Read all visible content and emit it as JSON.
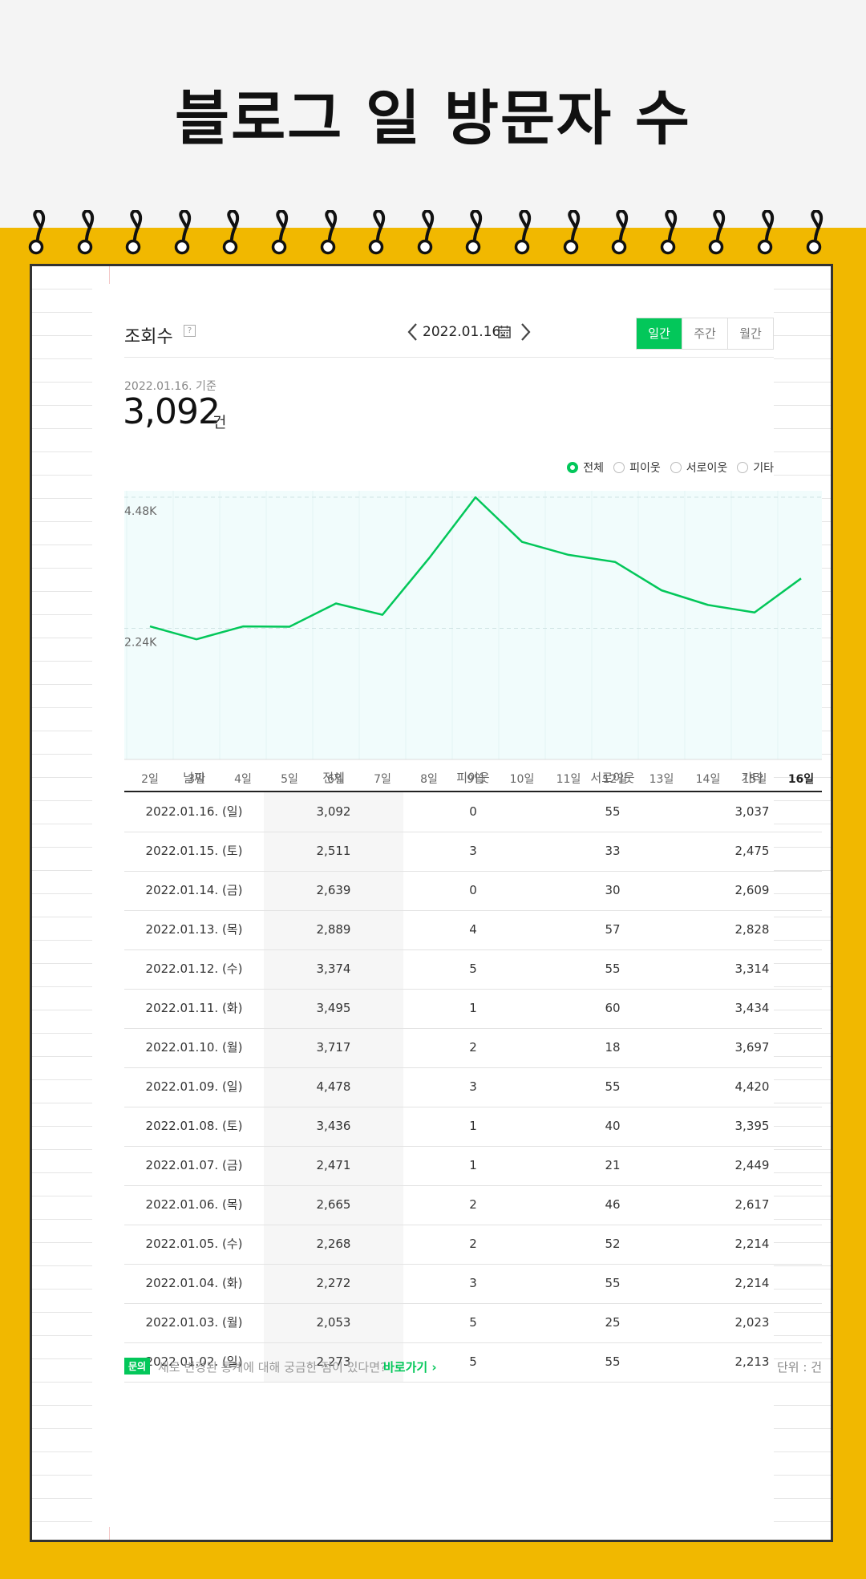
{
  "page": {
    "title": "블로그 일 방문자 수"
  },
  "stat": {
    "title": "조회수",
    "help": "?",
    "date": "2022.01.16.",
    "basis_date": "2022.01.16. 기준",
    "total": "3,092",
    "unit": "건",
    "period_tabs": [
      "일간",
      "주간",
      "월간"
    ],
    "active_period": "일간"
  },
  "legend": [
    "전체",
    "피이웃",
    "서로이웃",
    "기타"
  ],
  "selected_legend": "전체",
  "chart_data": {
    "type": "line",
    "categories": [
      "2일",
      "3일",
      "4일",
      "5일",
      "6일",
      "7일",
      "8일",
      "9일",
      "10일",
      "11일",
      "12일",
      "13일",
      "14일",
      "15일",
      "16일"
    ],
    "month_label": "1월",
    "series": [
      {
        "name": "전체",
        "values": [
          2273,
          2053,
          2272,
          2268,
          2665,
          2471,
          3436,
          4478,
          3717,
          3495,
          3374,
          2889,
          2639,
          2511,
          3092
        ]
      }
    ],
    "y_ticks": [
      "4.48K",
      "2.24K"
    ],
    "y_tick_values": [
      4480,
      2240
    ],
    "ylim": [
      0,
      4480
    ],
    "grid": true,
    "highlight_category": "16일",
    "line_color": "#03c75a",
    "area_color": "#f1fcfc"
  },
  "table": {
    "headers": [
      "날짜",
      "전체",
      "피이웃",
      "서로이웃",
      "기타"
    ],
    "rows": [
      [
        "2022.01.16. (일)",
        "3,092",
        "0",
        "55",
        "3,037"
      ],
      [
        "2022.01.15. (토)",
        "2,511",
        "3",
        "33",
        "2,475"
      ],
      [
        "2022.01.14. (금)",
        "2,639",
        "0",
        "30",
        "2,609"
      ],
      [
        "2022.01.13. (목)",
        "2,889",
        "4",
        "57",
        "2,828"
      ],
      [
        "2022.01.12. (수)",
        "3,374",
        "5",
        "55",
        "3,314"
      ],
      [
        "2022.01.11. (화)",
        "3,495",
        "1",
        "60",
        "3,434"
      ],
      [
        "2022.01.10. (월)",
        "3,717",
        "2",
        "18",
        "3,697"
      ],
      [
        "2022.01.09. (일)",
        "4,478",
        "3",
        "55",
        "4,420"
      ],
      [
        "2022.01.08. (토)",
        "3,436",
        "1",
        "40",
        "3,395"
      ],
      [
        "2022.01.07. (금)",
        "2,471",
        "1",
        "21",
        "2,449"
      ],
      [
        "2022.01.06. (목)",
        "2,665",
        "2",
        "46",
        "2,617"
      ],
      [
        "2022.01.05. (수)",
        "2,268",
        "2",
        "52",
        "2,214"
      ],
      [
        "2022.01.04. (화)",
        "2,272",
        "3",
        "55",
        "2,214"
      ],
      [
        "2022.01.03. (월)",
        "2,053",
        "5",
        "25",
        "2,023"
      ],
      [
        "2022.01.02. (일)",
        "2,273",
        "5",
        "55",
        "2,213"
      ]
    ]
  },
  "footer": {
    "badge": "문의",
    "text": "새로 변경된 통계에 대해 궁금한 점이 있다면?",
    "link": "바로가기 ›",
    "unit": "단위 : 건"
  },
  "colors": {
    "accent": "#03c75a",
    "background_yellow": "#f1b800"
  }
}
